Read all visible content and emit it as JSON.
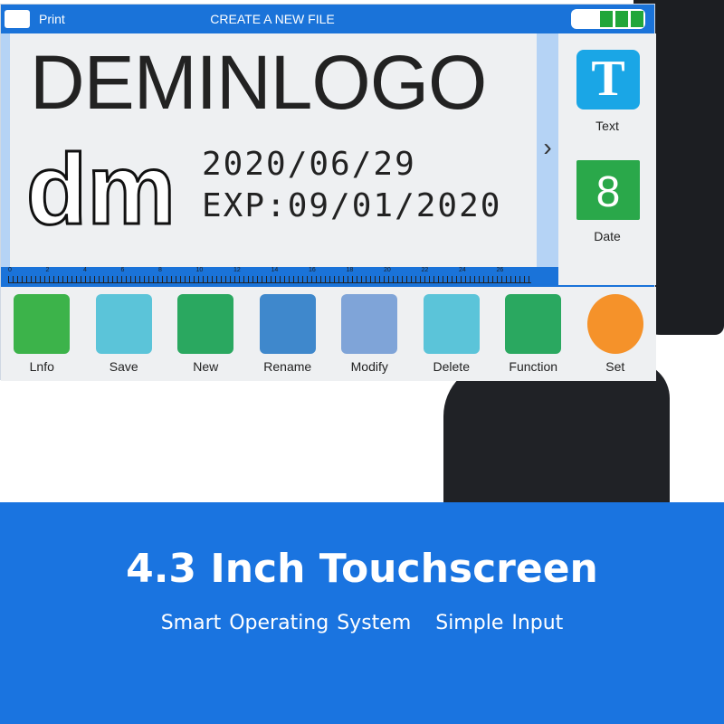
{
  "topbar": {
    "print_label": "Print",
    "title": "CREATE A NEW FILE",
    "battery_level": "3/3"
  },
  "canvas": {
    "logo_text": "DEMINLOGO",
    "dm_text": "dm",
    "date": "2020/06/29",
    "expiry": "EXP:09/01/2020"
  },
  "ruler": {
    "labels": [
      "0",
      "2",
      "4",
      "6",
      "8",
      "10",
      "12",
      "14",
      "16",
      "18",
      "20",
      "22",
      "24",
      "26"
    ]
  },
  "right_panel": [
    {
      "label": "Text",
      "glyph": "T",
      "color": "#1aa6e6"
    },
    {
      "label": "Date",
      "glyph": "8",
      "color": "#2aa84a"
    }
  ],
  "toolbar": [
    {
      "label": "Lnfo",
      "icon": "folder-icon",
      "color": "#3cb34a"
    },
    {
      "label": "Save",
      "icon": "save-icon",
      "color": "#5bc4d9"
    },
    {
      "label": "New",
      "icon": "new-file-icon",
      "color": "#2aa860"
    },
    {
      "label": "Rename",
      "icon": "code-file-icon",
      "color": "#3f88cc"
    },
    {
      "label": "Modify",
      "icon": "edit-doc-icon",
      "color": "#7fa4d8"
    },
    {
      "label": "Delete",
      "icon": "trash-icon",
      "color": "#5bc4d9"
    },
    {
      "label": "Function",
      "icon": "grid-icon",
      "color": "#2aa860"
    },
    {
      "label": "Set",
      "icon": "gear-icon",
      "color": "#f5922a"
    }
  ],
  "banner": {
    "headline": "4.3 Inch Touchscreen",
    "subline": "Smart Operating System   Simple Input"
  }
}
